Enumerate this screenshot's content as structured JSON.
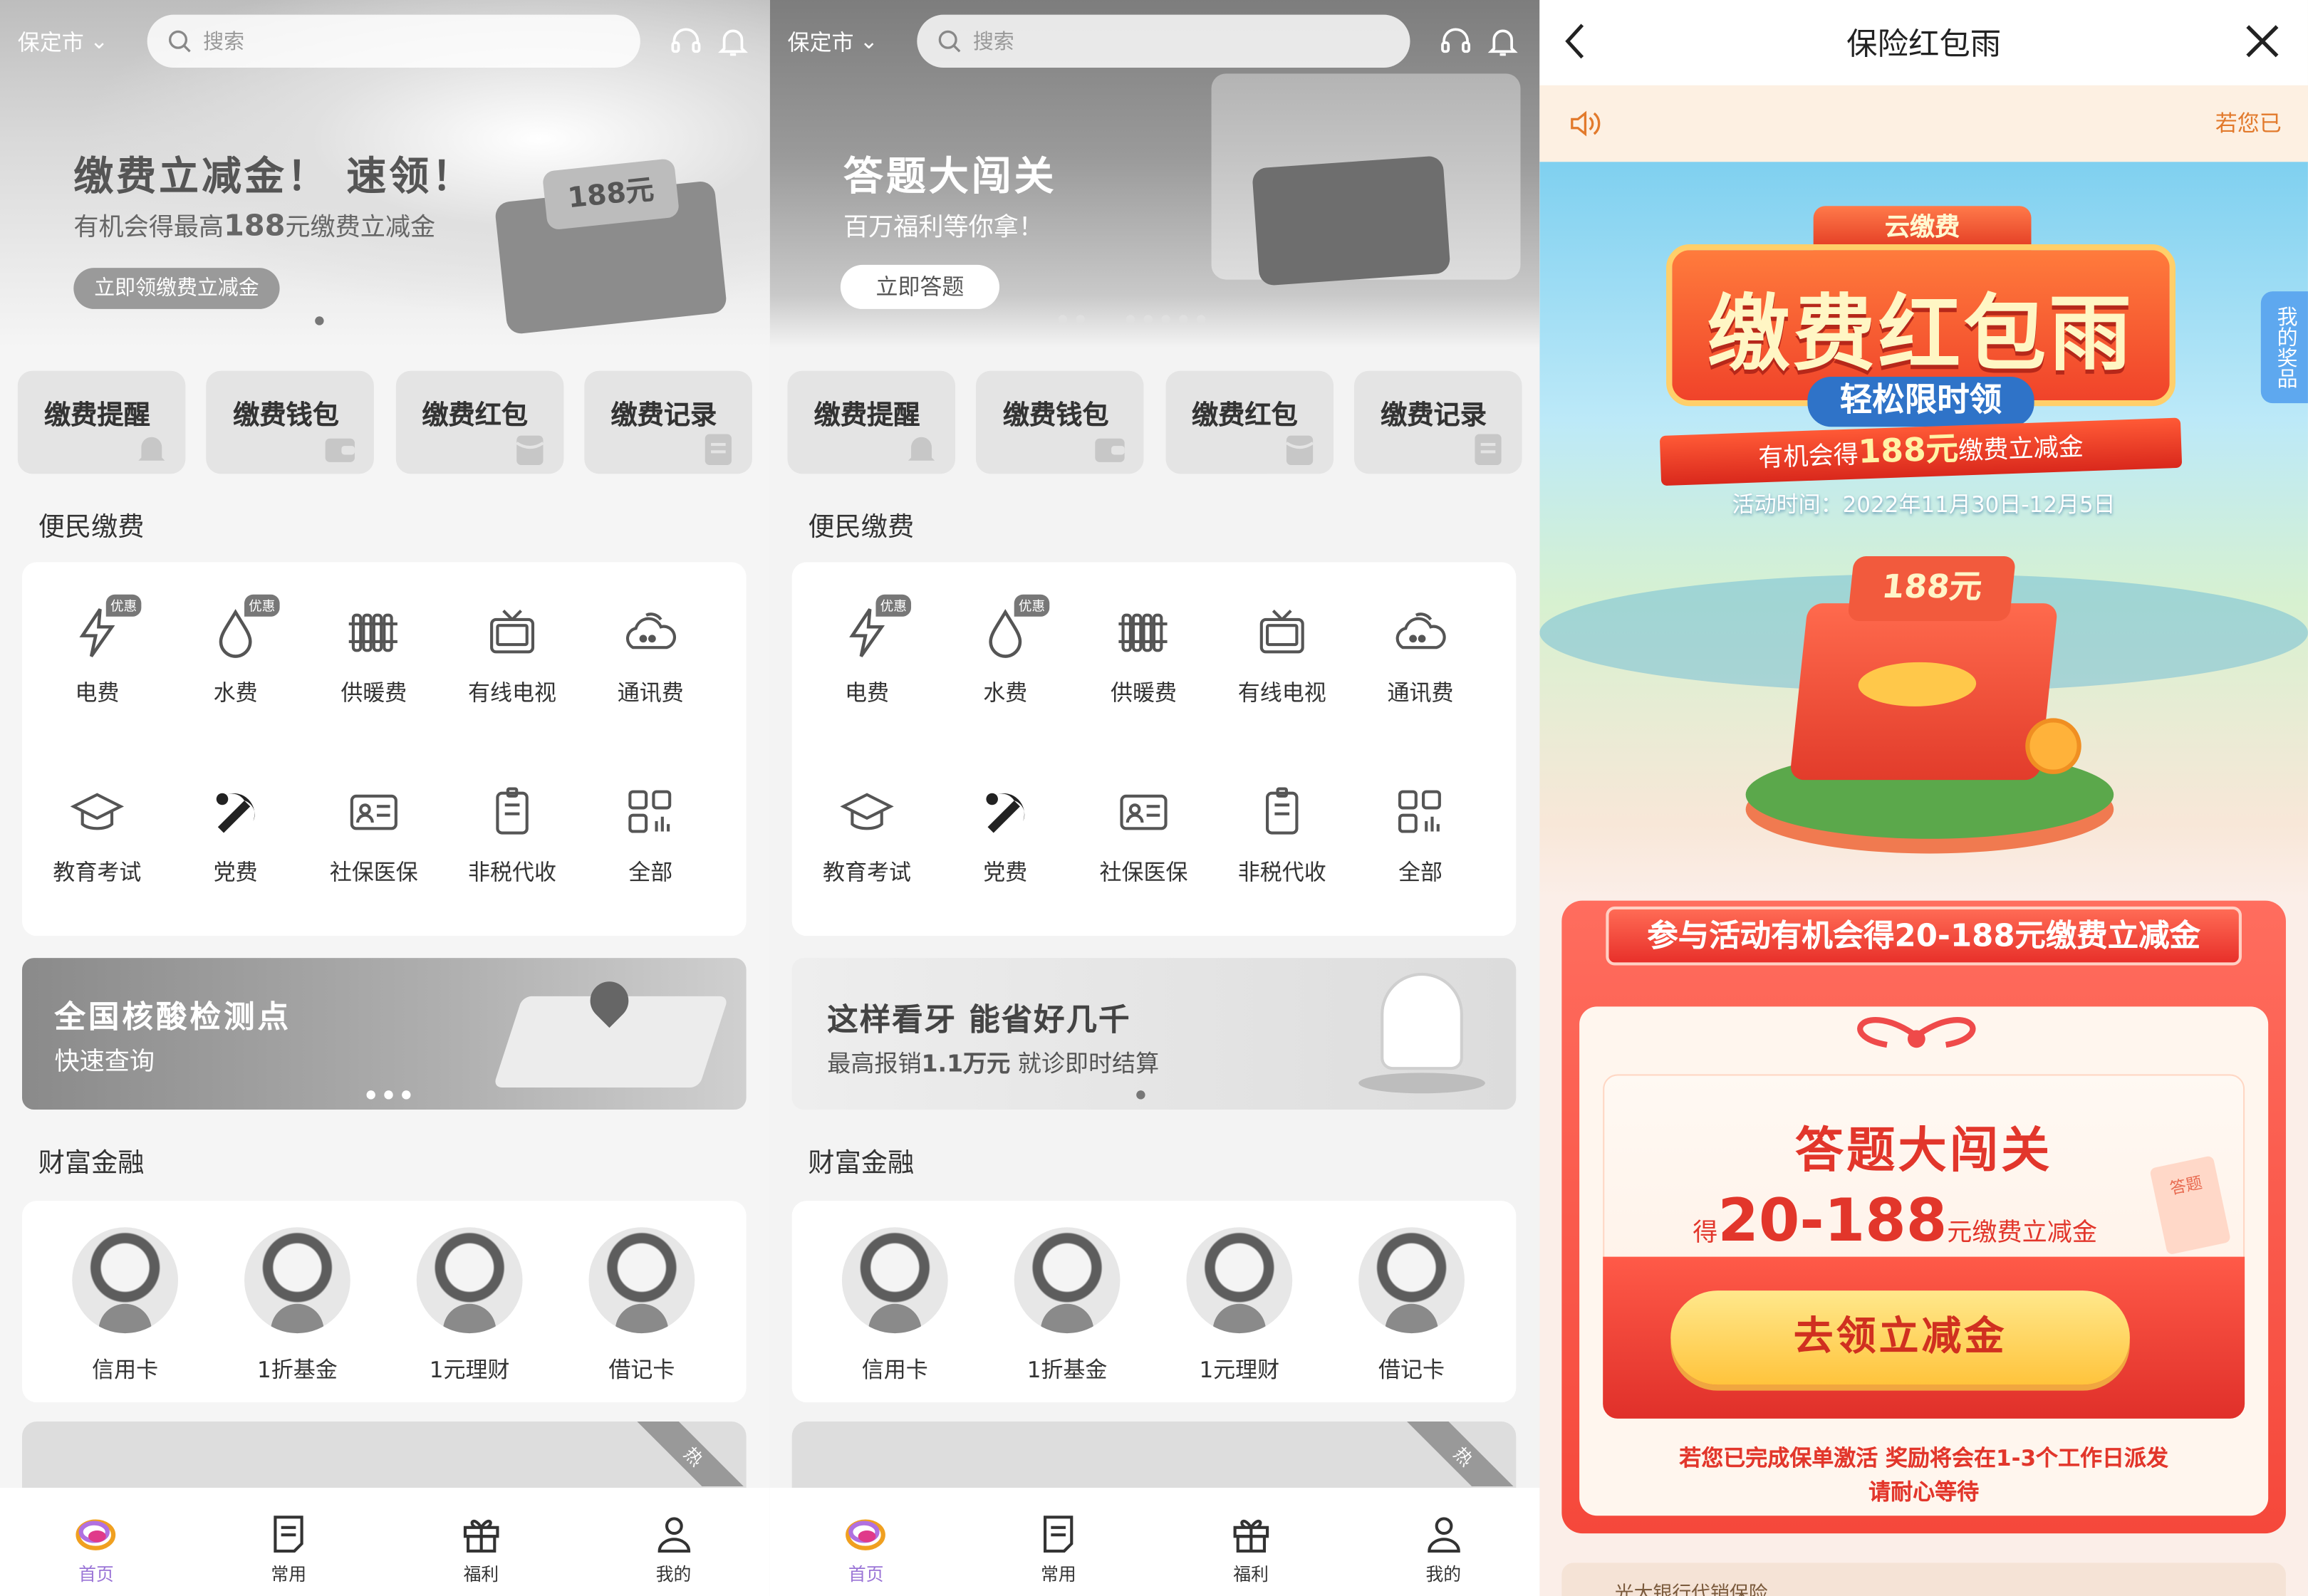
{
  "colors": {
    "accent_purple": "#9a74d6",
    "red_primary": "#f5483b",
    "gold_button": "#ffc43c",
    "notice_orange": "#e27a2c",
    "side_blue": "#5ea8ef"
  },
  "panels": [
    {
      "city": "保定市",
      "search_placeholder": "搜索",
      "banner": {
        "title": "缴费立减金！ 速领！",
        "sub_prefix": "有机会得最高",
        "sub_amount": "188",
        "sub_suffix": "元缴费立减金",
        "button": "立即领缴费立减金",
        "badge": "188元"
      },
      "quick": [
        "缴费提醒",
        "缴费钱包",
        "缴费红包",
        "缴费记录"
      ],
      "section_bills": "便民缴费",
      "services": [
        {
          "label": "电费",
          "tag": "优惠",
          "icon": "lightning-icon"
        },
        {
          "label": "水费",
          "tag": "优惠",
          "icon": "water-drop-icon"
        },
        {
          "label": "供暖费",
          "tag": "",
          "icon": "radiator-icon"
        },
        {
          "label": "有线电视",
          "tag": "",
          "icon": "tv-icon"
        },
        {
          "label": "通讯费",
          "tag": "",
          "icon": "phone-cloud-icon"
        },
        {
          "label": "教育考试",
          "tag": "",
          "icon": "graduation-cap-icon"
        },
        {
          "label": "党费",
          "tag": "",
          "icon": "party-emblem-icon"
        },
        {
          "label": "社保医保",
          "tag": "",
          "icon": "id-card-icon"
        },
        {
          "label": "非税代收",
          "tag": "",
          "icon": "receipt-icon"
        },
        {
          "label": "全部",
          "tag": "",
          "icon": "grid-icon"
        }
      ],
      "promo": {
        "title": "全国核酸检测点",
        "sub": "快速查询"
      },
      "section_finance": "财富金融",
      "finance": [
        {
          "label": "信用卡"
        },
        {
          "label": "1折基金"
        },
        {
          "label": "1元理财"
        },
        {
          "label": "借记卡"
        }
      ],
      "hot_label": "热"
    },
    {
      "city": "保定市",
      "search_placeholder": "搜索",
      "banner": {
        "title": "答题大闯关",
        "sub": "百万福利等你拿！",
        "button": "立即答题"
      },
      "quick": [
        "缴费提醒",
        "缴费钱包",
        "缴费红包",
        "缴费记录"
      ],
      "section_bills": "便民缴费",
      "services": [
        {
          "label": "电费",
          "tag": "优惠",
          "icon": "lightning-icon"
        },
        {
          "label": "水费",
          "tag": "优惠",
          "icon": "water-drop-icon"
        },
        {
          "label": "供暖费",
          "tag": "",
          "icon": "radiator-icon"
        },
        {
          "label": "有线电视",
          "tag": "",
          "icon": "tv-icon"
        },
        {
          "label": "通讯费",
          "tag": "",
          "icon": "phone-cloud-icon"
        },
        {
          "label": "教育考试",
          "tag": "",
          "icon": "graduation-cap-icon"
        },
        {
          "label": "党费",
          "tag": "",
          "icon": "party-emblem-icon"
        },
        {
          "label": "社保医保",
          "tag": "",
          "icon": "id-card-icon"
        },
        {
          "label": "非税代收",
          "tag": "",
          "icon": "receipt-icon"
        },
        {
          "label": "全部",
          "tag": "",
          "icon": "grid-icon"
        }
      ],
      "promo": {
        "title": "这样看牙 能省好几千",
        "sub_prefix": "最高报销",
        "sub_amount": "1.1万元",
        "sub_suffix": "就诊即时结算"
      },
      "section_finance": "财富金融",
      "finance": [
        {
          "label": "信用卡"
        },
        {
          "label": "1折基金"
        },
        {
          "label": "1元理财"
        },
        {
          "label": "借记卡"
        }
      ],
      "hot_label": "热"
    }
  ],
  "tabs": [
    {
      "label": "首页",
      "active": true
    },
    {
      "label": "常用"
    },
    {
      "label": "福利"
    },
    {
      "label": "我的"
    }
  ],
  "insurance": {
    "nav_title": "保险红包雨",
    "notice_text": "若您已",
    "brand": "云缴费",
    "main_title": "缴费红包雨",
    "ribbon_title": "轻松限时领",
    "ribbon_sub_prefix": "有机会得",
    "ribbon_sub_amount": "188元",
    "ribbon_sub_suffix": "缴费立减金",
    "period": "活动时间：2022年11月30日-12月5日",
    "gift_badge": "188元",
    "card_header": "参与活动有机会得20-188元缴费立减金",
    "quiz_title": "答题大闯关",
    "reward_prefix": "得",
    "reward_amount": "20-188",
    "reward_suffix": "元缴费立减金",
    "button": "去领立减金",
    "footnote_1": "若您已完成保单激活 奖励将会在1-3个工作日派发",
    "footnote_2": "请耐心等待",
    "side_tab": "我的奖品",
    "bottom_text": "光大银行代销保险",
    "side_note": "答题"
  }
}
